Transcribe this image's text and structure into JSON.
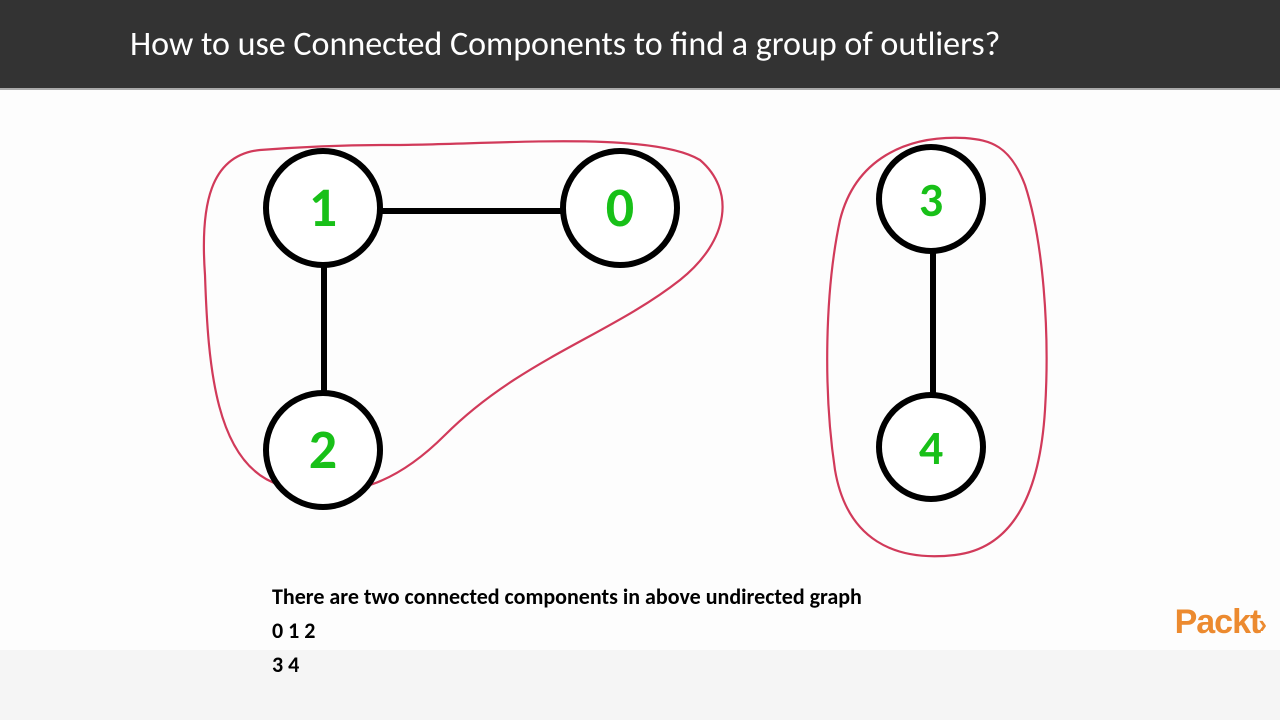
{
  "header": {
    "title": "How to use Connected Components to find a group of outliers?"
  },
  "graph": {
    "nodes": {
      "n0": "0",
      "n1": "1",
      "n2": "2",
      "n3": "3",
      "n4": "4"
    },
    "edges": [
      {
        "from": 1,
        "to": 0
      },
      {
        "from": 1,
        "to": 2
      },
      {
        "from": 3,
        "to": 4
      }
    ],
    "components": [
      [
        0,
        1,
        2
      ],
      [
        3,
        4
      ]
    ]
  },
  "description": {
    "line1": "There are two connected components in above undirected graph",
    "line2": "0 1 2",
    "line3": "3 4"
  },
  "brand": "Packt"
}
